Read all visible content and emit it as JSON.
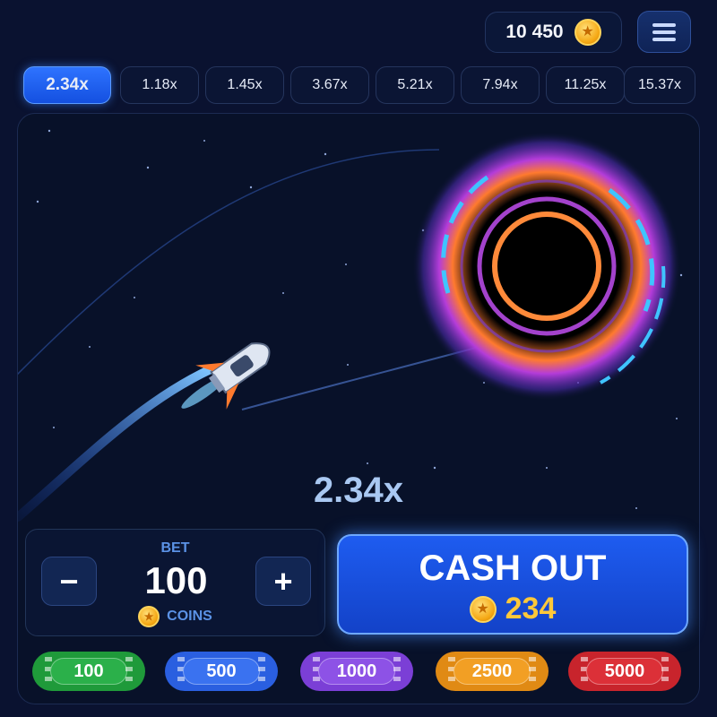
{
  "header": {
    "balance": "10 450",
    "coin_icon": "star-coin",
    "menu_icon": "hamburger-menu"
  },
  "history": [
    {
      "label": "2.34x",
      "active": true
    },
    {
      "label": "1.18x",
      "active": false
    },
    {
      "label": "1.45x",
      "active": false
    },
    {
      "label": "3.67x",
      "active": false
    },
    {
      "label": "5.21x",
      "active": false
    },
    {
      "label": "7.94x",
      "active": false
    },
    {
      "label": "11.25x",
      "active": false
    },
    {
      "label": "15.37x",
      "active": false
    }
  ],
  "game": {
    "multiplier": "2.34x",
    "scene": [
      "rocket",
      "black-hole",
      "flight-trail",
      "stars"
    ]
  },
  "bet": {
    "label": "BET",
    "value": "100",
    "unit": "COINS",
    "minus": "−",
    "plus": "+"
  },
  "cashout": {
    "label": "CASH OUT",
    "amount": "234"
  },
  "chips": [
    {
      "value": "100",
      "color": "#1f9a3a"
    },
    {
      "value": "500",
      "color": "#2a5fe0"
    },
    {
      "value": "1000",
      "color": "#7b3fd6"
    },
    {
      "value": "2500",
      "color": "#e08a14"
    },
    {
      "value": "5000",
      "color": "#c8242c"
    }
  ],
  "colors": {
    "accent": "#2e73ff",
    "background": "#0a1230",
    "coin": "#f5a814",
    "multiplier_text": "#a9c8f2"
  }
}
